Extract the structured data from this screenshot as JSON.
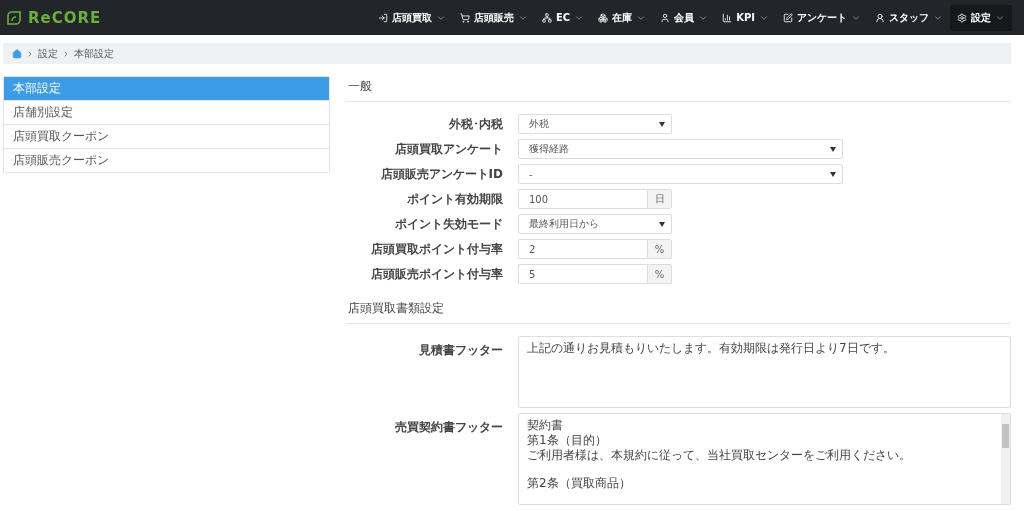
{
  "navbar": {
    "logo": "ReCORE",
    "menu": [
      {
        "label": "店頭買取",
        "selected": false
      },
      {
        "label": "店頭販売",
        "selected": false
      },
      {
        "label": "EC",
        "selected": false
      },
      {
        "label": "在庫",
        "selected": false
      },
      {
        "label": "会員",
        "selected": false
      },
      {
        "label": "KPI",
        "selected": false
      },
      {
        "label": "アンケート",
        "selected": false
      },
      {
        "label": "スタッフ",
        "selected": false
      },
      {
        "label": "設定",
        "selected": true
      }
    ]
  },
  "breadcrumb": [
    "設定",
    "本部設定"
  ],
  "sidebar": {
    "items": [
      {
        "label": "本部設定",
        "selected": true
      },
      {
        "label": "店舗別設定",
        "selected": false
      },
      {
        "label": "店頭買取クーポン",
        "selected": false
      },
      {
        "label": "店頭販売クーポン",
        "selected": false
      }
    ]
  },
  "sections": [
    {
      "title": "一般",
      "fields": [
        {
          "kind": "select",
          "label": "外税･内税",
          "value": "外税",
          "wide": false
        },
        {
          "kind": "select",
          "label": "店頭買取アンケート",
          "value": "獲得経路",
          "wide": true
        },
        {
          "kind": "select",
          "label": "店頭販売アンケートID",
          "value": "-",
          "wide": true
        },
        {
          "kind": "addon",
          "label": "ポイント有効期限",
          "value": "100",
          "addon": "日"
        },
        {
          "kind": "select",
          "label": "ポイント失効モード",
          "value": "最終利用日から",
          "wide": false
        },
        {
          "kind": "addon",
          "label": "店頭買取ポイント付与率",
          "value": "2",
          "addon": "%"
        },
        {
          "kind": "addon",
          "label": "店頭販売ポイント付与率",
          "value": "5",
          "addon": "%"
        }
      ]
    },
    {
      "title": "店頭買取書類設定",
      "fields": [
        {
          "kind": "textarea",
          "label": "見積書フッター",
          "paragraphs": [
            [
              "上記の通りお見積もりいたします。有効期限は発行日より7日です。"
            ]
          ],
          "scroll": false
        },
        {
          "kind": "textarea",
          "label": "売買契約書フッター",
          "paragraphs": [
            [
              "契約書",
              "第1条（目的）",
              "ご利用者様は、本規約に従って、当社買取センターをご利用ください。"
            ],
            [
              "第2条（買取商品）"
            ]
          ],
          "scroll": true
        }
      ]
    }
  ]
}
